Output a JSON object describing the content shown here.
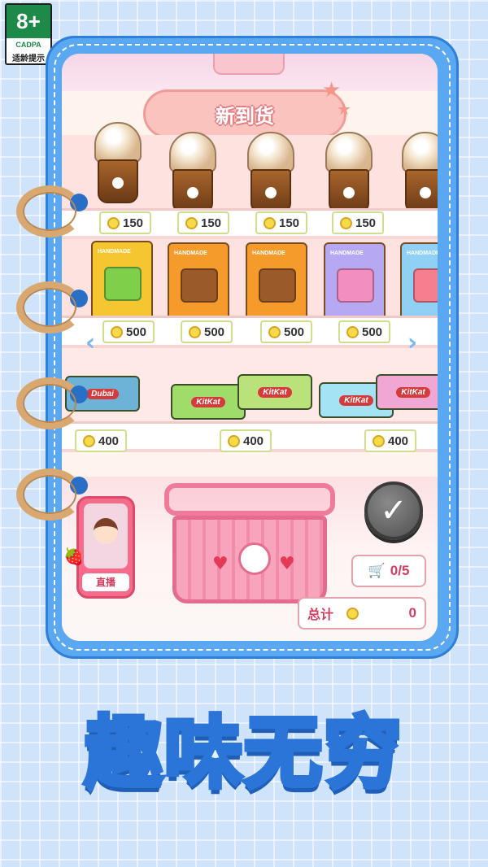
{
  "age_badge": {
    "rating": "8+",
    "org": "CADPA",
    "note": "适龄提示"
  },
  "shelf_sign": "新到货",
  "shelves": [
    {
      "prices": [
        "150",
        "150",
        "150",
        "150"
      ]
    },
    {
      "prices": [
        "500",
        "500",
        "500",
        "500"
      ]
    },
    {
      "prices": [
        "400",
        "400",
        "400"
      ]
    }
  ],
  "live_button_label": "直播",
  "cart": {
    "count": "0/5"
  },
  "total": {
    "label": "总计",
    "value": "0"
  },
  "slogan": "趣味无穷",
  "colors": {
    "frame": "#5aa7f2",
    "accent_pink": "#f07a9a",
    "price_border": "#cfdd8f",
    "coin": "#f6da4a"
  },
  "icons": [
    "cart-icon",
    "coin-icon",
    "check-icon",
    "chevron-left-icon",
    "chevron-right-icon",
    "strawberry-icon"
  ]
}
